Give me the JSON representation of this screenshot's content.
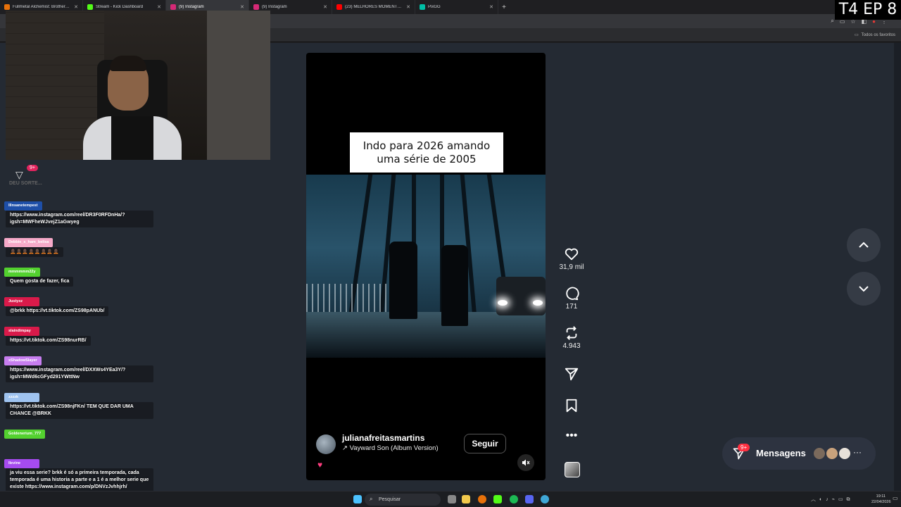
{
  "browser": {
    "tabs": [
      {
        "label": "Fullmetal Alchemist: Brotherhood",
        "color": "#e8710a",
        "active": false
      },
      {
        "label": "Stream - Kick Dashboard",
        "color": "#53fc18",
        "active": false
      },
      {
        "label": "(9) Instagram",
        "color": "#d62976",
        "active": true
      },
      {
        "label": "(9) Instagram",
        "color": "#d62976",
        "active": false
      },
      {
        "label": "(23) MELHORES MOMENTOS: F",
        "color": "#ff0000",
        "active": false
      },
      {
        "label": "PixGG",
        "color": "#00bfa5",
        "active": false
      }
    ],
    "new_tab": "+",
    "bookmarks_label": "Todos os favoritos"
  },
  "overlay": {
    "episode_label": "T4 EP 8"
  },
  "chat": {
    "badge": "9+",
    "caption": "DEU SORTE...",
    "messages": [
      {
        "user": "lllnsanetempest",
        "color": "#1e4fa8",
        "text": "https://www.instagram.com/reel/DR3F0RFDnHa/?igsh=MWFheWJvejZ1aGwyeg"
      },
      {
        "user": "Debbie_s_ham_belisa",
        "color": "#f5a9c8",
        "text": "🧑🏿‍🦲🧑🏿‍🦲🧑🏿‍🦲🧑🏿‍🦲🧑🏿‍🦲🧑🏿‍🦲🧑🏿‍🦲🧑🏿‍🦲"
      },
      {
        "user": "mmmmmm22y",
        "color": "#53d12f",
        "text": "Quem gosta de fazer, fica"
      },
      {
        "user": "Justyxz",
        "color": "#d91a4a",
        "text": "@brkk https://vt.tiktok.com/ZS98pANUb/"
      },
      {
        "user": "slaindimpay",
        "color": "#d91a4a",
        "text": "https://vt.tiktok.com/ZS98nurRB/"
      },
      {
        "user": "xShadowSlayer",
        "color": "#c77ef0",
        "text": "https://www.instagram.com/reel/DXXWs4YEa3Y/?igsh=MWd6cGFyd291YWttNw"
      },
      {
        "user": "zzzzk",
        "color": "#9fc3f0",
        "text": "https://vt.tiktok.com/ZS98njFKn/ TEM QUE DAR UMA CHANCE @BRKK"
      },
      {
        "user": "Goldenerium_777",
        "color": "#53d12f",
        "text": ""
      },
      {
        "user": "llevine",
        "color": "#a64bf0",
        "text": "ja viu essa serie? brkk é só a primeira temporada, cada temporada é uma historia a parte e a 1 é a melhor serie que existe https://www.instagram.com/p/DNVzJvhhjrh/"
      }
    ]
  },
  "reel": {
    "caption_line1": "Indo para 2026 amando",
    "caption_line2": "uma série de 2005",
    "author": "julianafreitasmartins",
    "music": "Vayward Son (Album Version)",
    "follow_label": "Seguir",
    "likes": "31,9 mil",
    "comments": "171",
    "reposts": "4.943"
  },
  "icons": {
    "like": "heart-icon",
    "comment": "comment-icon",
    "repost": "repost-icon",
    "share": "send-icon",
    "save": "bookmark-icon",
    "more": "more-icon",
    "nav_up": "chevron-up-icon",
    "nav_down": "chevron-down-icon",
    "mute": "muted-speaker-icon"
  },
  "messages_panel": {
    "label": "Mensagens",
    "badge": "9+"
  },
  "taskbar": {
    "search_placeholder": "Pesquisar",
    "time": "19:11",
    "date": "22/04/2026"
  },
  "colors": {
    "page_bg": "#242a33",
    "accent_red": "#ff3040",
    "follow_border": "#555555"
  }
}
